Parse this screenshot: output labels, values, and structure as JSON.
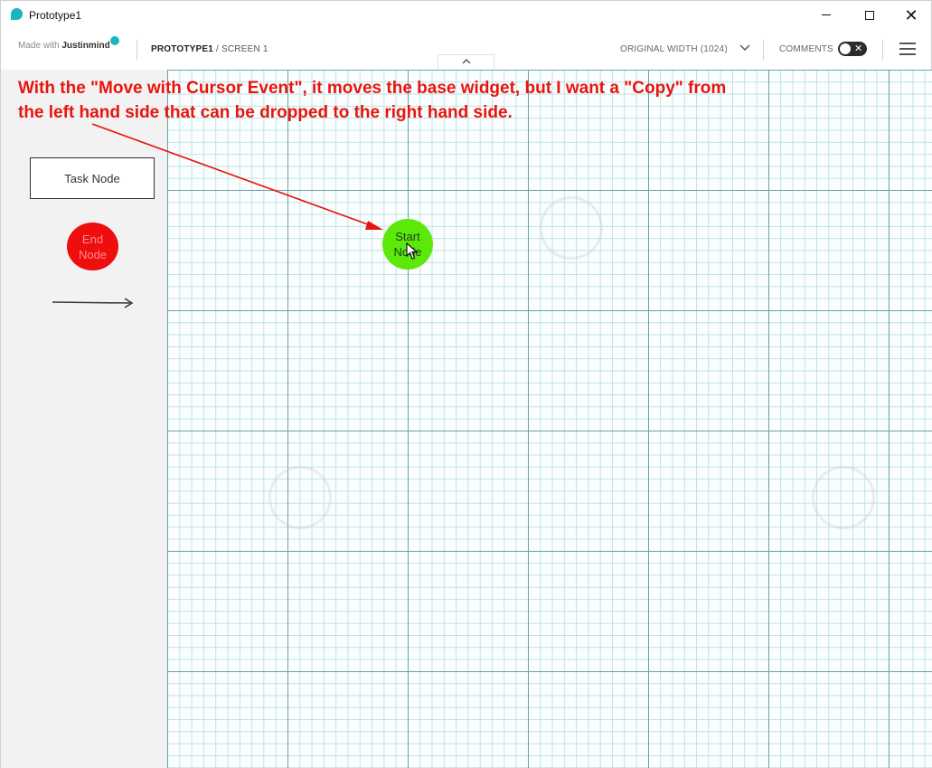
{
  "window": {
    "title": "Prototype1",
    "minimize_glyph": "",
    "maximize_glyph": "",
    "close_glyph": "✕"
  },
  "toolbar": {
    "brand_prefix": "Made with ",
    "brand_name": "Justinmind",
    "project": "PROTOTYPE1",
    "screen": " / SCREEN 1",
    "width_option": "ORIGINAL WIDTH (1024)",
    "comments_label": "COMMENTS",
    "comments_toggle": "✕"
  },
  "widgets": {
    "task_node": "Task Node",
    "end_node_line1": "End",
    "end_node_line2": "Node",
    "start_node_line1": "Start",
    "start_node_line2": "Node"
  },
  "annotation": {
    "line1": "With the \"Move with Cursor Event\", it moves the base widget, but I want a \"Copy\" from",
    "line2": "the left hand side that can be dropped to the right hand side.",
    "color": "#e8140f"
  },
  "colors": {
    "brand": "#1bb5c0",
    "end_node": "#ee0e0e",
    "start_node": "#5ce90a",
    "panel": "#f2f2f2"
  }
}
